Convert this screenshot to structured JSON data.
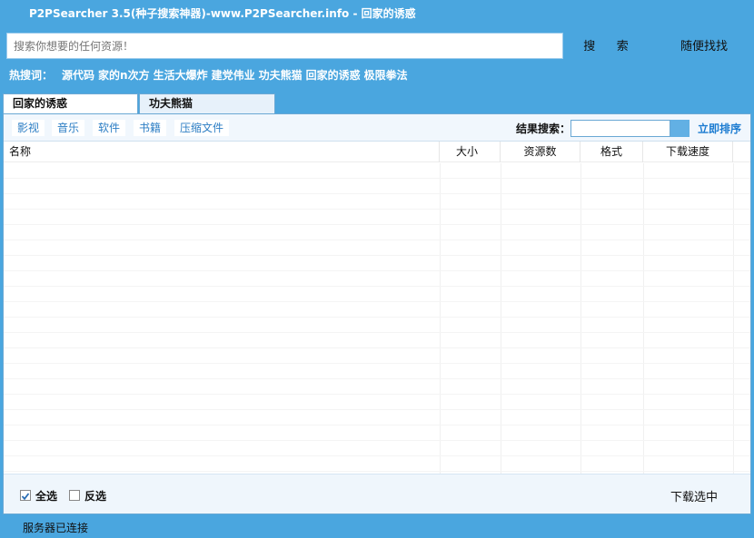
{
  "window": {
    "title": "P2PSearcher 3.5(种子搜索神器)-www.P2PSearcher.info - 回家的诱惑"
  },
  "search": {
    "placeholder": "搜索你想要的任何资源！",
    "search_label": "搜 索",
    "random_label": "随便找找"
  },
  "hot": {
    "label": "热搜词：",
    "keywords": [
      "源代码",
      "家的n次方",
      "生活大爆炸",
      "建党伟业",
      "功夫熊猫",
      "回家的诱惑",
      "极限拳法"
    ]
  },
  "tabs": [
    {
      "label": "回家的诱惑",
      "active": true
    },
    {
      "label": "功夫熊猫",
      "active": false
    }
  ],
  "categories": [
    "影视",
    "音乐",
    "软件",
    "书籍",
    "压缩文件"
  ],
  "result_search": {
    "label": "结果搜索：",
    "value": ""
  },
  "sort_label": "立即排序",
  "table": {
    "columns": [
      "名称",
      "大小",
      "资源数",
      "格式",
      "下载速度"
    ]
  },
  "bottom": {
    "select_all": "全选",
    "select_all_checked": true,
    "invert": "反选",
    "invert_checked": false,
    "download_label": "下载选中"
  },
  "status": {
    "text": "服务器已连接"
  },
  "colors": {
    "window_blue": "#4aa6df",
    "link_blue": "#1c7cd1"
  }
}
